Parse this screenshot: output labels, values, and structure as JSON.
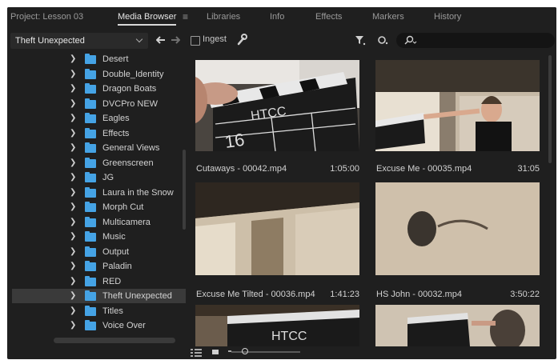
{
  "tabs": [
    {
      "label": "Project: Lesson 03",
      "active": false
    },
    {
      "label": "Media Browser",
      "active": true
    },
    {
      "label": "Libraries",
      "active": false
    },
    {
      "label": "Info",
      "active": false
    },
    {
      "label": "Effects",
      "active": false
    },
    {
      "label": "Markers",
      "active": false
    },
    {
      "label": "History",
      "active": false
    }
  ],
  "toolbar": {
    "location": "Theft Unexpected",
    "ingest_label": "Ingest",
    "ingest_checked": false,
    "search_value": "",
    "search_placeholder": ""
  },
  "tree": [
    {
      "label": "Desert"
    },
    {
      "label": "Double_Identity"
    },
    {
      "label": "Dragon Boats"
    },
    {
      "label": "DVCPro NEW"
    },
    {
      "label": "Eagles"
    },
    {
      "label": "Effects"
    },
    {
      "label": "General Views"
    },
    {
      "label": "Greenscreen"
    },
    {
      "label": "JG"
    },
    {
      "label": "Laura in the Snow"
    },
    {
      "label": "Morph Cut"
    },
    {
      "label": "Multicamera"
    },
    {
      "label": "Music"
    },
    {
      "label": "Output"
    },
    {
      "label": "Paladin"
    },
    {
      "label": "RED"
    },
    {
      "label": "Theft Unexpected",
      "selected": true
    },
    {
      "label": "Titles"
    },
    {
      "label": "Voice Over"
    }
  ],
  "clips": [
    {
      "name": "Cutaways - 00042.mp4",
      "duration": "1:05:00"
    },
    {
      "name": "Excuse Me - 00035.mp4",
      "duration": "31:05"
    },
    {
      "name": "Excuse Me Tilted - 00036.mp4",
      "duration": "1:41:23"
    },
    {
      "name": "HS John - 00032.mp4",
      "duration": "3:50:22"
    },
    {
      "name": "",
      "duration": ""
    },
    {
      "name": "",
      "duration": ""
    }
  ],
  "zoom_level": 0.2,
  "colors": {
    "folder": "#45a3e5",
    "panel_bg": "#1f1f1f",
    "selection": "#3a3a3a"
  }
}
